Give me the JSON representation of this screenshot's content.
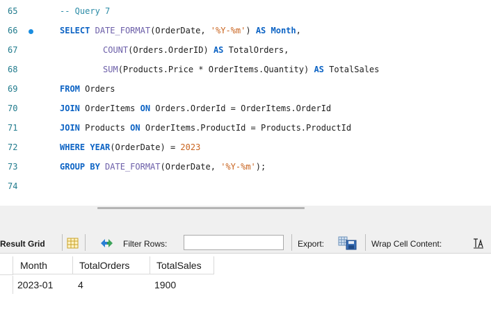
{
  "editor": {
    "lines": [
      {
        "num": "65",
        "breakpoint": false
      },
      {
        "num": "66",
        "breakpoint": true
      },
      {
        "num": "67",
        "breakpoint": false
      },
      {
        "num": "68",
        "breakpoint": false
      },
      {
        "num": "69",
        "breakpoint": false
      },
      {
        "num": "70",
        "breakpoint": false
      },
      {
        "num": "71",
        "breakpoint": false
      },
      {
        "num": "72",
        "breakpoint": false
      },
      {
        "num": "73",
        "breakpoint": false
      },
      {
        "num": "74",
        "breakpoint": false
      }
    ],
    "code": {
      "l65": {
        "comment": "-- Query 7"
      },
      "l66": {
        "select": "SELECT",
        "fn": "DATE_FORMAT",
        "a": "(OrderDate, ",
        "fmt": "'%Y-%m'",
        "b": ") ",
        "as": "AS",
        "alias": " Month,",
        "alias_kw": "Month"
      },
      "l67": {
        "fn": "COUNT",
        "a": "(Orders.OrderID) ",
        "as": "AS",
        "alias": " TotalOrders,"
      },
      "l68": {
        "fn": "SUM",
        "a": "(Products.Price * OrderItems.Quantity) ",
        "as": "AS",
        "alias": " TotalSales"
      },
      "l69": {
        "from": "FROM",
        "a": " Orders"
      },
      "l70": {
        "join": "JOIN",
        "a": " OrderItems ",
        "on": "ON",
        "b": " Orders.OrderId = OrderItems.OrderId"
      },
      "l71": {
        "join": "JOIN",
        "a": " Products ",
        "on": "ON",
        "b": " OrderItems.ProductId = Products.ProductId"
      },
      "l72": {
        "where": "WHERE",
        "fn": " YEAR",
        "a": "(OrderDate) = ",
        "num": "2023"
      },
      "l73": {
        "group": "GROUP BY",
        "fn": " DATE_FORMAT",
        "a": "(OrderDate, ",
        "fmt": "'%Y-%m'",
        "b": ");"
      }
    }
  },
  "toolbar": {
    "result_grid": "Result Grid",
    "filter_rows": "Filter Rows:",
    "filter_value": "",
    "export": "Export:",
    "wrap_cell": "Wrap Cell Content:"
  },
  "grid": {
    "columns": [
      "Month",
      "TotalOrders",
      "TotalSales"
    ],
    "rows": [
      [
        "2023-01",
        "4",
        "1900"
      ]
    ]
  },
  "colors": {
    "keyword": "#0c63c4",
    "function": "#6b5ea8",
    "string": "#c9641f",
    "line_number": "#1f7a8c",
    "breakpoint": "#1a8de0"
  }
}
